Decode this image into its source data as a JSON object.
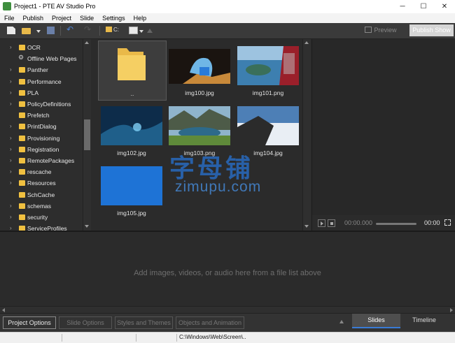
{
  "window": {
    "title": "Project1 - PTE AV Studio Pro",
    "controls": [
      "─",
      "☐",
      "✕"
    ]
  },
  "menu": [
    "File",
    "Publish",
    "Project",
    "Slide",
    "Settings",
    "Help"
  ],
  "toolbar": {
    "drive_label": "C:",
    "preview_label": "Preview",
    "publish_label": "Publish Show"
  },
  "folders": [
    {
      "label": "OCR",
      "icon": "folder-icon",
      "expandable": true
    },
    {
      "label": "Offline Web Pages",
      "icon": "web-folder-icon",
      "expandable": false
    },
    {
      "label": "Panther",
      "icon": "folder-icon",
      "expandable": true
    },
    {
      "label": "Performance",
      "icon": "folder-icon",
      "expandable": true
    },
    {
      "label": "PLA",
      "icon": "folder-icon",
      "expandable": true
    },
    {
      "label": "PolicyDefinitions",
      "icon": "folder-icon",
      "expandable": true
    },
    {
      "label": "Prefetch",
      "icon": "folder-icon",
      "expandable": false
    },
    {
      "label": "PrintDialog",
      "icon": "folder-icon",
      "expandable": true
    },
    {
      "label": "Provisioning",
      "icon": "folder-icon",
      "expandable": true
    },
    {
      "label": "Registration",
      "icon": "folder-icon",
      "expandable": true
    },
    {
      "label": "RemotePackages",
      "icon": "folder-icon",
      "expandable": true
    },
    {
      "label": "rescache",
      "icon": "folder-icon",
      "expandable": true
    },
    {
      "label": "Resources",
      "icon": "folder-icon",
      "expandable": true
    },
    {
      "label": "SchCache",
      "icon": "folder-icon",
      "expandable": false
    },
    {
      "label": "schemas",
      "icon": "folder-icon",
      "expandable": true
    },
    {
      "label": "security",
      "icon": "folder-icon",
      "expandable": true
    },
    {
      "label": "ServiceProfiles",
      "icon": "folder-icon",
      "expandable": true
    }
  ],
  "files": [
    {
      "name": "..",
      "kind": "parent-folder"
    },
    {
      "name": "img100.jpg",
      "kind": "image"
    },
    {
      "name": "img101.png",
      "kind": "image"
    },
    {
      "name": "img102.jpg",
      "kind": "image"
    },
    {
      "name": "img103.png",
      "kind": "image"
    },
    {
      "name": "img104.jpg",
      "kind": "image"
    },
    {
      "name": "img105.jpg",
      "kind": "image"
    }
  ],
  "player": {
    "time_current": "00:00.000",
    "time_total": "00:00"
  },
  "dropzone": {
    "message": "Add images, videos, or audio here from a file list above"
  },
  "bottom": {
    "project_options": "Project Options",
    "slide_options": "Slide Options",
    "styles_themes": "Styles and Themes",
    "objects_animation": "Objects and Animation",
    "tab_slides": "Slides",
    "tab_timeline": "Timeline"
  },
  "status": {
    "path": "C:\\Windows\\Web\\Screen\\.."
  },
  "watermark": {
    "cn": "字母铺",
    "en": "zimupu.com"
  }
}
